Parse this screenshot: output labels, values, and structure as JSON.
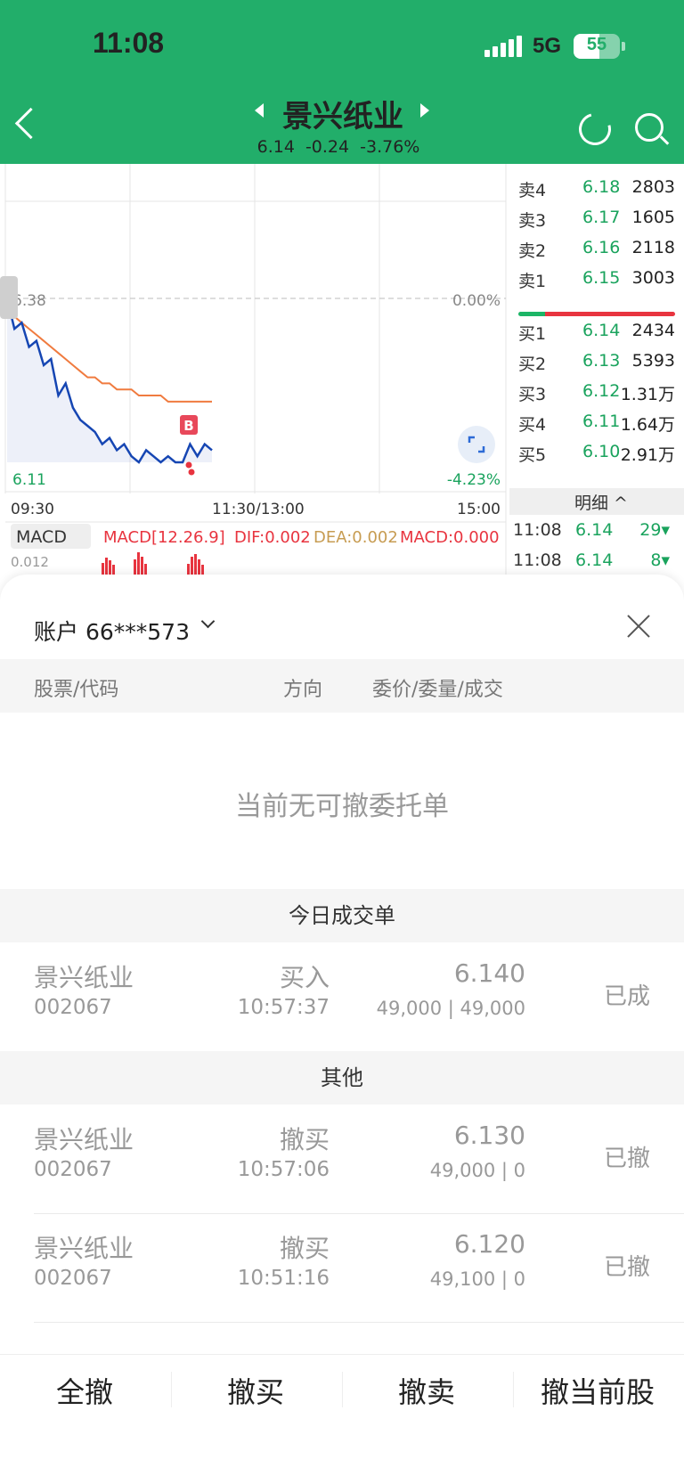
{
  "status_bar": {
    "time": "11:08",
    "network": "5G",
    "battery": "55",
    "battery_level": 0.55
  },
  "header": {
    "title": "景兴纸业",
    "price": "6.14",
    "change": "-0.24",
    "change_pct": "-3.76%"
  },
  "chart": {
    "price_high_label": "6.38",
    "pct_high_label": "0.00%",
    "price_low_label": "6.11",
    "pct_low_label": "-4.23%",
    "time_start": "09:30",
    "time_mid": "11:30/13:00",
    "time_end": "15:00",
    "marker": "B",
    "macd_selector": "MACD",
    "macd_params": "MACD[12.26.9]",
    "dif": "DIF:0.002",
    "dea": "DEA:0.002",
    "macd_value": "MACD:0.000",
    "macd_axis": "0.012",
    "colors": {
      "price_line": "#1646b3",
      "avg_line": "#f07b3f",
      "up": "#e8343f",
      "down": "#1aa35d"
    }
  },
  "chart_data": {
    "type": "line",
    "title": "",
    "xlabel": "",
    "ylabel": "",
    "x_ticks": [
      "09:30",
      "11:30/13:00",
      "15:00"
    ],
    "ylim": [
      6.11,
      6.38
    ],
    "series": [
      {
        "values": [
          6.38,
          6.33,
          6.34,
          6.3,
          6.31,
          6.27,
          6.28,
          6.22,
          6.24,
          6.2,
          6.18,
          6.17,
          6.16,
          6.14,
          6.15,
          6.13,
          6.14,
          6.12,
          6.11,
          6.13,
          6.12,
          6.11,
          6.12,
          6.11,
          6.11,
          6.14,
          6.12,
          6.14,
          6.13
        ]
      },
      {
        "values": [
          6.38,
          6.35,
          6.34,
          6.33,
          6.32,
          6.31,
          6.3,
          6.29,
          6.28,
          6.27,
          6.26,
          6.25,
          6.25,
          6.24,
          6.24,
          6.23,
          6.23,
          6.23,
          6.22,
          6.22,
          6.22,
          6.22,
          6.21,
          6.21,
          6.21,
          6.21,
          6.21,
          6.21,
          6.21
        ]
      }
    ]
  },
  "order_book": {
    "asks": [
      {
        "label": "卖4",
        "price": "6.18",
        "volume": "2803"
      },
      {
        "label": "卖3",
        "price": "6.17",
        "volume": "1605"
      },
      {
        "label": "卖2",
        "price": "6.16",
        "volume": "2118"
      },
      {
        "label": "卖1",
        "price": "6.15",
        "volume": "3003"
      }
    ],
    "bids": [
      {
        "label": "买1",
        "price": "6.14",
        "volume": "2434"
      },
      {
        "label": "买2",
        "price": "6.13",
        "volume": "5393"
      },
      {
        "label": "买3",
        "price": "6.12",
        "volume": "1.31万"
      },
      {
        "label": "买4",
        "price": "6.11",
        "volume": "1.64万"
      },
      {
        "label": "买5",
        "price": "6.10",
        "volume": "2.91万"
      }
    ],
    "detail_label": "明细 ^",
    "ticks": [
      {
        "time": "11:08",
        "price": "6.14",
        "volume": "29▾"
      },
      {
        "time": "11:08",
        "price": "6.14",
        "volume": "8▾"
      }
    ]
  },
  "sheet": {
    "account": "账户 66***573",
    "columns": {
      "stock": "股票/代码",
      "direction": "方向",
      "price": "委价/委量/成交"
    },
    "empty_message": "当前无可撤委托单",
    "today_section": "今日成交单",
    "other_section": "其他",
    "today_orders": [
      {
        "name": "景兴纸业",
        "code": "002067",
        "direction": "买入",
        "time": "10:57:37",
        "price": "6.140",
        "qty": "49,000 | 49,000",
        "status": "已成"
      }
    ],
    "other_orders": [
      {
        "name": "景兴纸业",
        "code": "002067",
        "direction": "撤买",
        "time": "10:57:06",
        "price": "6.130",
        "qty": "49,000 | 0",
        "status": "已撤"
      },
      {
        "name": "景兴纸业",
        "code": "002067",
        "direction": "撤买",
        "time": "10:51:16",
        "price": "6.120",
        "qty": "49,100 | 0",
        "status": "已撤"
      }
    ]
  },
  "bottom_actions": {
    "cancel_all": "全撤",
    "cancel_buy": "撤买",
    "cancel_sell": "撤卖",
    "cancel_current": "撤当前股"
  }
}
